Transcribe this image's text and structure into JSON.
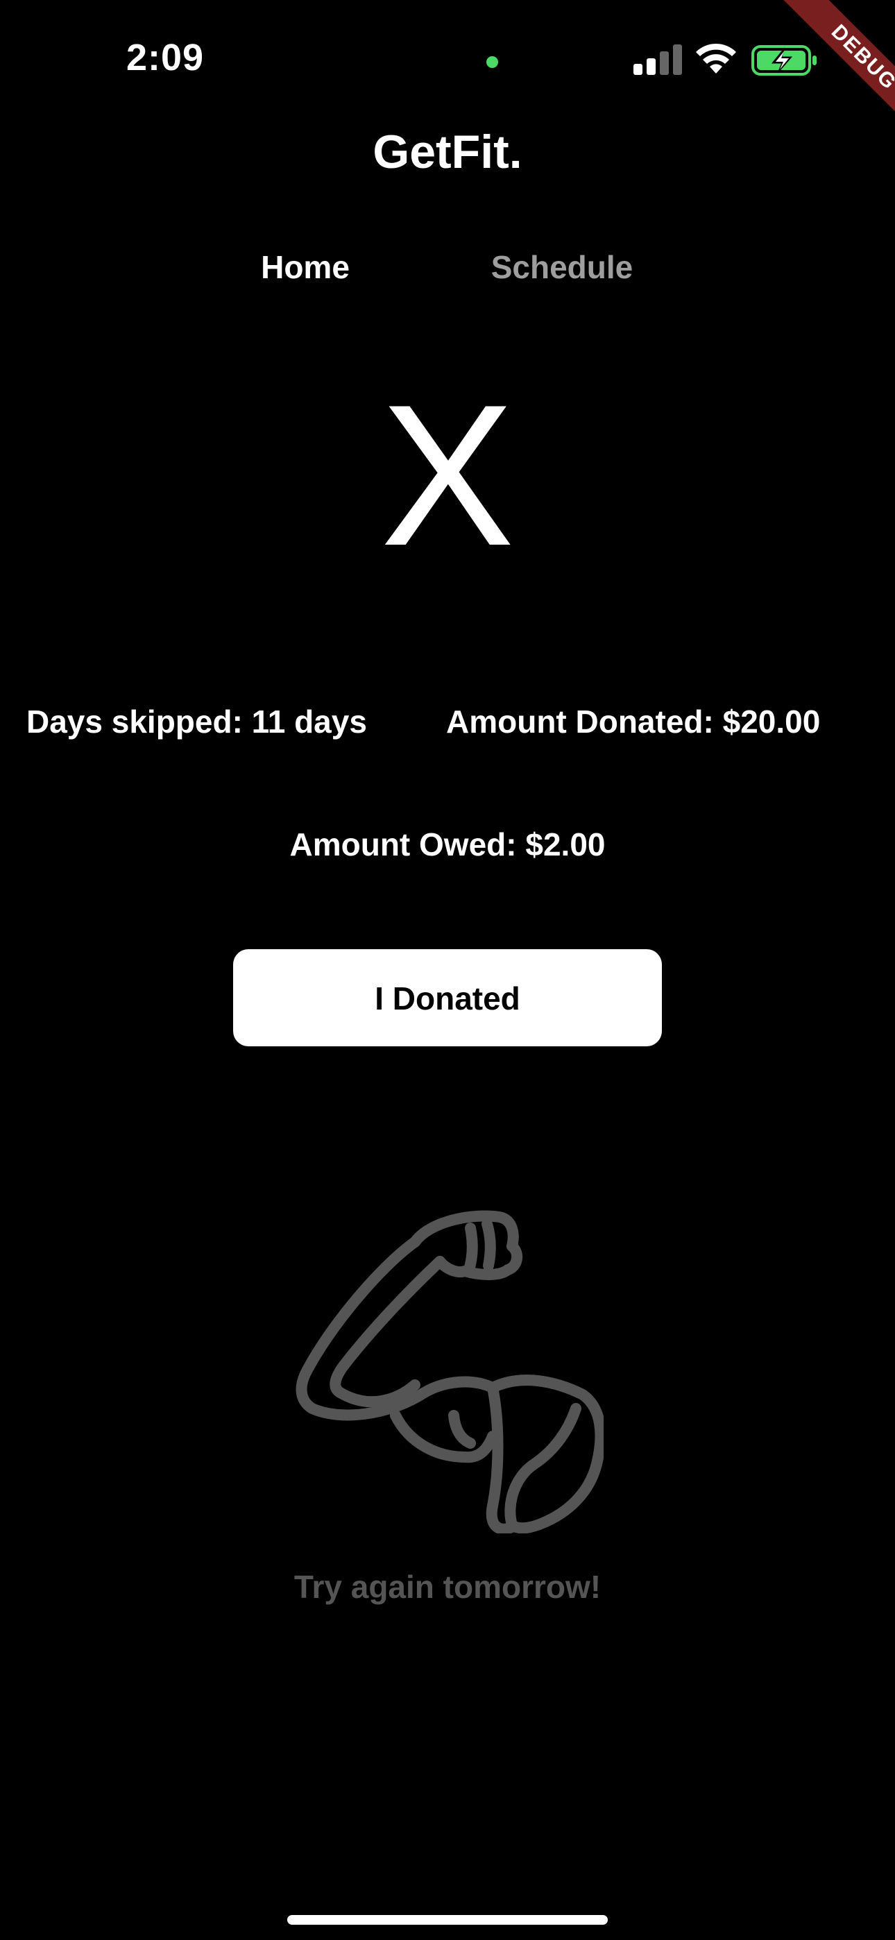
{
  "status_bar": {
    "time": "2:09",
    "privacy_dot_color": "#4cd964",
    "battery_color": "#4cd964"
  },
  "debug_banner": "DEBUG",
  "app": {
    "title": "GetFit."
  },
  "tabs": [
    {
      "label": "Home",
      "active": true
    },
    {
      "label": "Schedule",
      "active": false
    }
  ],
  "status_symbol": "X",
  "stats": {
    "days_skipped": "Days skipped: 11 days",
    "amount_donated": "Amount Donated: $20.00",
    "amount_owed": "Amount Owed: $2.00"
  },
  "donate_button": {
    "label": "I Donated"
  },
  "illustration": {
    "icon": "flexed-bicep-icon",
    "color": "#555555"
  },
  "message": "Try again tomorrow!"
}
